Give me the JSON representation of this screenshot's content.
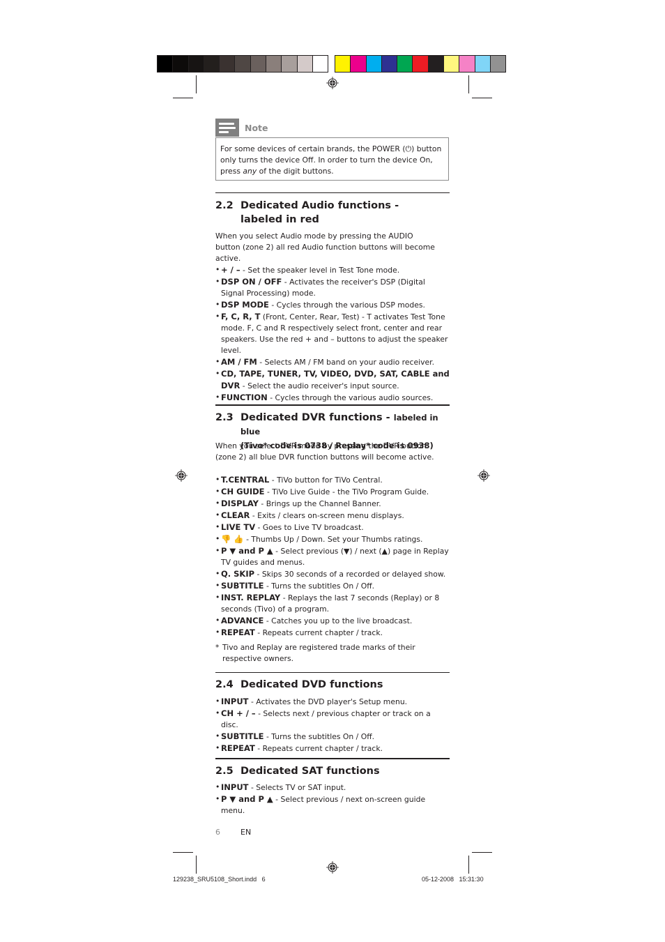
{
  "print_marks": {
    "grayscale_swatches": [
      "#000000",
      "#0d0b0a",
      "#171413",
      "#231f1d",
      "#3a3230",
      "#4f4744",
      "#6a605d",
      "#8a7f7b",
      "#a89f9c",
      "#d4cac9",
      "#ffffff"
    ],
    "color_swatches": [
      "#fff200",
      "#ec008c",
      "#00aeef",
      "#2e3192",
      "#00a651",
      "#ed1c24",
      "#231f20",
      "#fff77f",
      "#f582c6",
      "#80d5f7",
      "#929292"
    ],
    "slug_left": "129238_SRU5108_Short.indd   6",
    "slug_right": "05-12-2008   15:31:30"
  },
  "note": {
    "label": "Note",
    "text_1": "For some devices of certain brands, the POWER (⏻)  button only turns the device Off. In order to turn the device On, press ",
    "text_em": "any",
    "text_2": " of the digit buttons."
  },
  "sections": {
    "s22": {
      "number": "2.2",
      "title": "Dedicated Audio functions - labeled in red",
      "intro": "When you select Audio mode by pressing the AUDIO button (zone 2) all red Audio function buttons will become active.",
      "items": [
        {
          "key": "+ / –",
          "desc": " - Set the speaker level in Test Tone mode."
        },
        {
          "key": "DSP ON / OFF",
          "desc": " - Activates the receiver's DSP (Digital Signal Processing) mode."
        },
        {
          "key": "DSP MODE",
          "desc": " - Cycles through the various DSP modes."
        },
        {
          "key": "F, C, R, T",
          "desc": " (Front, Center, Rear, Test) - T activates Test Tone mode. F, C and R respectively select front, center and rear speakers. Use the red + and – buttons to adjust the speaker level."
        },
        {
          "key": "AM / FM",
          "desc": " - Selects AM / FM band on your audio receiver."
        },
        {
          "key": "CD, TAPE, TUNER, TV, VIDEO, DVD, SAT, CABLE and DVR",
          "desc": " - Select the audio receiver's input source."
        },
        {
          "key": "FUNCTION",
          "desc": " - Cycles through the various audio sources."
        }
      ]
    },
    "s23": {
      "number": "2.3",
      "title": "Dedicated DVR functions - ",
      "title_small": "labeled in blue",
      "subtitle": "(Tivo* code is 0738 / Replay* code is 0938)",
      "intro": "When you select DVR mode by pressing the DVR button (zone 2) all blue DVR function buttons will become active.",
      "items": [
        {
          "key": "T.CENTRAL",
          "desc": " - TiVo button for TiVo Central."
        },
        {
          "key": "CH GUIDE",
          "desc": " - TiVo Live Guide - the TiVo Program Guide."
        },
        {
          "key": "DISPLAY",
          "desc": " - Brings up the Channel Banner."
        },
        {
          "key": "CLEAR",
          "desc": " - Exits / clears on-screen menu displays."
        },
        {
          "key": "LIVE TV",
          "desc": " - Goes to Live TV broadcast."
        },
        {
          "key": "👎 👍",
          "desc": " -  Thumbs Up / Down. Set your Thumbs ratings."
        },
        {
          "key": "P ▼ and P ▲",
          "desc": " - Select previous (▼) / next (▲) page in Replay TV guides and menus."
        },
        {
          "key": "Q. SKIP",
          "desc": " - Skips 30 seconds of a recorded or delayed show."
        },
        {
          "key": "SUBTITLE",
          "desc": " - Turns the subtitles On / Off."
        },
        {
          "key": "INST. REPLAY",
          "desc": " - Replays the last 7 seconds (Replay) or 8 seconds (Tivo) of a program."
        },
        {
          "key": "ADVANCE",
          "desc": " - Catches you up to the live broadcast."
        },
        {
          "key": "REPEAT",
          "desc": " - Repeats current chapter / track."
        }
      ],
      "footnote_mark": "*",
      "footnote": "Tivo and Replay are registered trade marks of their respective owners."
    },
    "s24": {
      "number": "2.4",
      "title": "Dedicated DVD functions",
      "items": [
        {
          "key": "INPUT",
          "desc": " - Activates the DVD player's Setup menu."
        },
        {
          "key": "CH + / –",
          "desc": " - Selects next / previous chapter or track on a disc."
        },
        {
          "key": "SUBTITLE",
          "desc": " - Turns the subtitles On / Off."
        },
        {
          "key": "REPEAT",
          "desc": " - Repeats current chapter / track."
        }
      ]
    },
    "s25": {
      "number": "2.5",
      "title": "Dedicated SAT functions",
      "items": [
        {
          "key": "INPUT",
          "desc": " - Selects TV or SAT input."
        },
        {
          "key": "P ▼ and P ▲",
          "desc": " - Select previous / next on-screen guide menu."
        }
      ]
    }
  },
  "footer": {
    "page_number": "6",
    "language": "EN"
  }
}
